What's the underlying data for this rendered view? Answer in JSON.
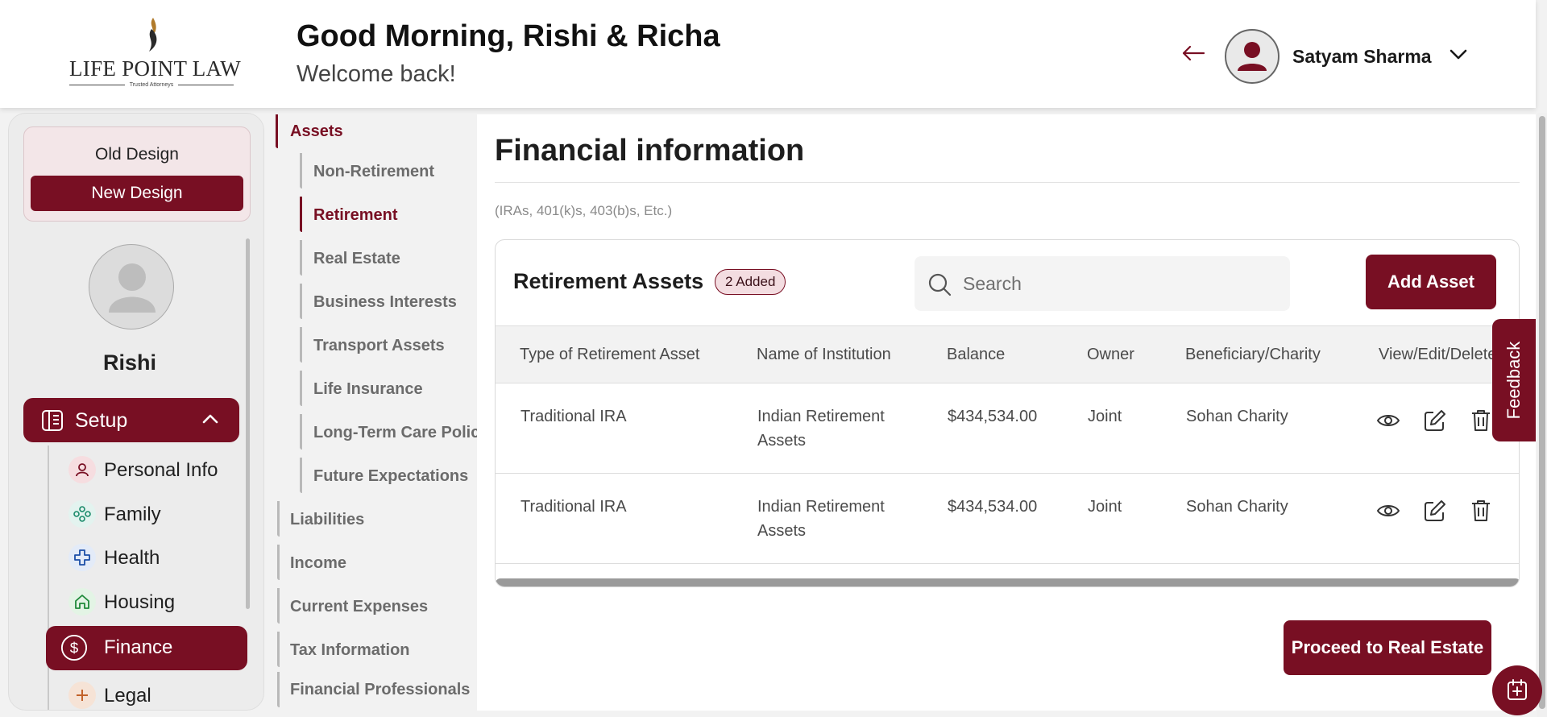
{
  "brand": {
    "name": "LIFE POINT LAW",
    "tagline": "Trusted Attorneys"
  },
  "header": {
    "greeting": "Good Morning, Rishi & Richa",
    "subtitle": "Welcome back!",
    "user_name": "Satyam Sharma"
  },
  "sidebar": {
    "old_design": "Old Design",
    "new_design": "New Design",
    "profile_name": "Rishi",
    "setup_label": "Setup",
    "items": [
      {
        "label": "Personal Info",
        "icon": "person-icon"
      },
      {
        "label": "Family",
        "icon": "family-icon"
      },
      {
        "label": "Health",
        "icon": "health-cross-icon"
      },
      {
        "label": "Housing",
        "icon": "house-icon"
      },
      {
        "label": "Finance",
        "icon": "dollar-icon"
      },
      {
        "label": "Legal",
        "icon": "legal-icon"
      }
    ]
  },
  "subnav": {
    "assets": "Assets",
    "asset_items": [
      "Non-Retirement",
      "Retirement",
      "Real Estate",
      "Business Interests",
      "Transport Assets",
      "Life Insurance",
      "Long-Term Care Policy",
      "Future Expectations"
    ],
    "sections": [
      "Liabilities",
      "Income",
      "Current Expenses",
      "Tax Information",
      "Financial Professionals"
    ]
  },
  "main": {
    "title": "Financial information",
    "subtitle": "(IRAs, 401(k)s, 403(b)s, Etc.)",
    "card_title": "Retirement Assets",
    "badge": "2 Added",
    "search_placeholder": "Search",
    "add_button": "Add Asset",
    "columns": [
      "Type of Retirement Asset",
      "Name of Institution",
      "Balance",
      "Owner",
      "Beneficiary/Charity",
      "View/Edit/Delete"
    ],
    "rows": [
      {
        "type": "Traditional IRA",
        "institution_line1": "Indian Retirement",
        "institution_line2": "Assets",
        "balance": "$434,534.00",
        "owner": "Joint",
        "beneficiary": "Sohan Charity"
      },
      {
        "type": "Traditional IRA",
        "institution_line1": "Indian Retirement",
        "institution_line2": "Assets",
        "balance": "$434,534.00",
        "owner": "Joint",
        "beneficiary": "Sohan Charity"
      }
    ],
    "proceed_button": "Proceed to Real Estate"
  },
  "feedback_label": "Feedback",
  "colors": {
    "brand": "#780f23",
    "badge_bg": "#f3dde1"
  }
}
